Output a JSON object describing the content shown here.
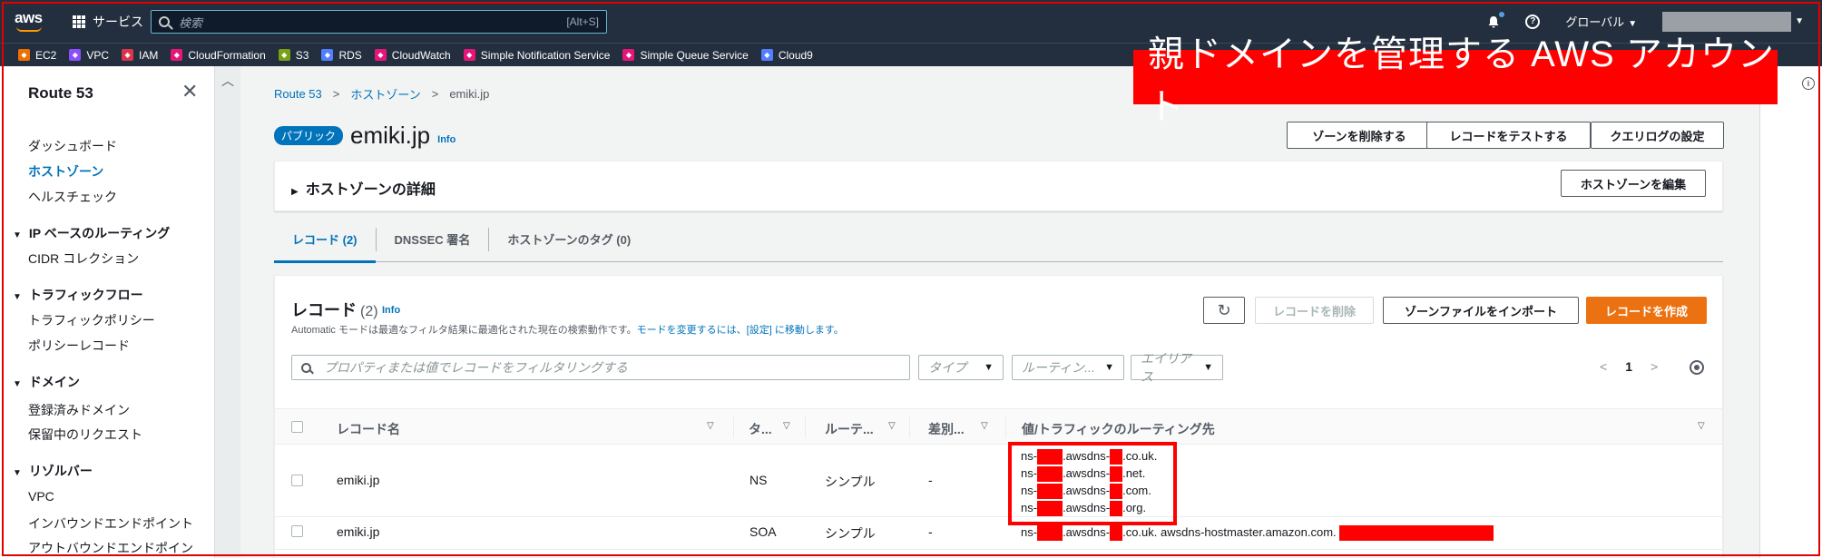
{
  "topnav": {
    "services_label": "サービス",
    "search_placeholder": "検索",
    "search_shortcut": "[Alt+S]",
    "region_label": "グローバル"
  },
  "favorites": [
    {
      "label": "EC2",
      "color": "#ed7100"
    },
    {
      "label": "VPC",
      "color": "#8c4fff"
    },
    {
      "label": "IAM",
      "color": "#dd344c"
    },
    {
      "label": "CloudFormation",
      "color": "#e7157b"
    },
    {
      "label": "S3",
      "color": "#7aa116"
    },
    {
      "label": "RDS",
      "color": "#527fff"
    },
    {
      "label": "CloudWatch",
      "color": "#e7157b"
    },
    {
      "label": "Simple Notification Service",
      "color": "#e7157b"
    },
    {
      "label": "Simple Queue Service",
      "color": "#e7157b"
    },
    {
      "label": "Cloud9",
      "color": "#527fff"
    }
  ],
  "sidebar": {
    "title": "Route 53",
    "items": [
      "ダッシュボード",
      "ホストゾーン",
      "ヘルスチェック"
    ],
    "sections": [
      {
        "label": "IP ベースのルーティング",
        "items": [
          "CIDR コレクション"
        ]
      },
      {
        "label": "トラフィックフロー",
        "items": [
          "トラフィックポリシー",
          "ポリシーレコード"
        ]
      },
      {
        "label": "ドメイン",
        "items": [
          "登録済みドメイン",
          "保留中のリクエスト"
        ]
      },
      {
        "label": "リゾルバー",
        "items": [
          "VPC",
          "インバウンドエンドポイント",
          "アウトバウンドエンドポイン"
        ]
      }
    ]
  },
  "breadcrumb": {
    "root": "Route 53",
    "section": "ホストゾーン",
    "current": "emiki.jp"
  },
  "annotation": "親ドメインを管理する AWS アカウント",
  "zone": {
    "badge": "パブリック",
    "name": "emiki.jp",
    "info": "Info",
    "buttons": {
      "delete": "ゾーンを削除する",
      "test": "レコードをテストする",
      "query_log": "クエリログの設定"
    }
  },
  "details": {
    "label": "ホストゾーンの詳細",
    "edit_button": "ホストゾーンを編集"
  },
  "tabs": [
    "レコード (2)",
    "DNSSEC 署名",
    "ホストゾーンのタグ (0)"
  ],
  "records": {
    "title": "レコード",
    "count": "(2)",
    "info": "Info",
    "desc": "Automatic モードは最適なフィルタ結果に最適化された現在の検索動作です。",
    "desc_link": "モードを変更するには、[設定] に移動します。",
    "delete_button": "レコードを削除",
    "import_button": "ゾーンファイルをインポート",
    "create_button": "レコードを作成",
    "filter_placeholder": "プロパティまたは値でレコードをフィルタリングする",
    "dropdowns": [
      "タイプ",
      "ルーティン...",
      "エイリアス"
    ],
    "page": "1",
    "columns": [
      "レコード名",
      "タ...",
      "ルーテ...",
      "差別...",
      "値/トラフィックのルーティング先"
    ],
    "rows": [
      {
        "name": "emiki.jp",
        "type": "NS",
        "routing": "シンプル",
        "diff": "-",
        "values": [
          {
            "a": "ns-",
            "b": ".awsdns-",
            "c": ".co.uk."
          },
          {
            "a": "ns-",
            "b": ".awsdns-",
            "c": ".net."
          },
          {
            "a": "ns-",
            "b": ".awsdns-",
            "c": ".com."
          },
          {
            "a": "ns-",
            "b": ".awsdns-",
            "c": ".org."
          }
        ]
      },
      {
        "name": "emiki.jp",
        "type": "SOA",
        "routing": "シンプル",
        "diff": "-",
        "soa": {
          "a": "ns-",
          "b": ".awsdns-",
          "c": ".co.uk. awsdns-hostmaster.amazon.com."
        }
      }
    ]
  },
  "colors": {
    "nav_bg": "#232f3e",
    "link": "#0073bb",
    "primary": "#ec7211",
    "redaction": "#ff0000"
  }
}
